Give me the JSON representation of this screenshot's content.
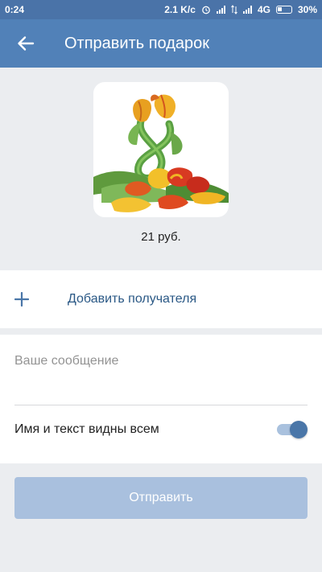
{
  "status_bar": {
    "time": "0:24",
    "speed": "2.1 K/c",
    "network": "4G",
    "battery": "30%"
  },
  "header": {
    "title": "Отправить подарок"
  },
  "gift": {
    "price": "21 руб."
  },
  "recipient": {
    "add_label": "Добавить получателя"
  },
  "message": {
    "placeholder": "Ваше сообщение"
  },
  "visibility": {
    "label": "Имя и текст видны всем",
    "enabled": true
  },
  "send": {
    "label": "Отправить"
  },
  "colors": {
    "header": "#5181b8",
    "accent": "#4a76a8",
    "link": "#2a5885",
    "button_disabled": "#a9c0de"
  }
}
